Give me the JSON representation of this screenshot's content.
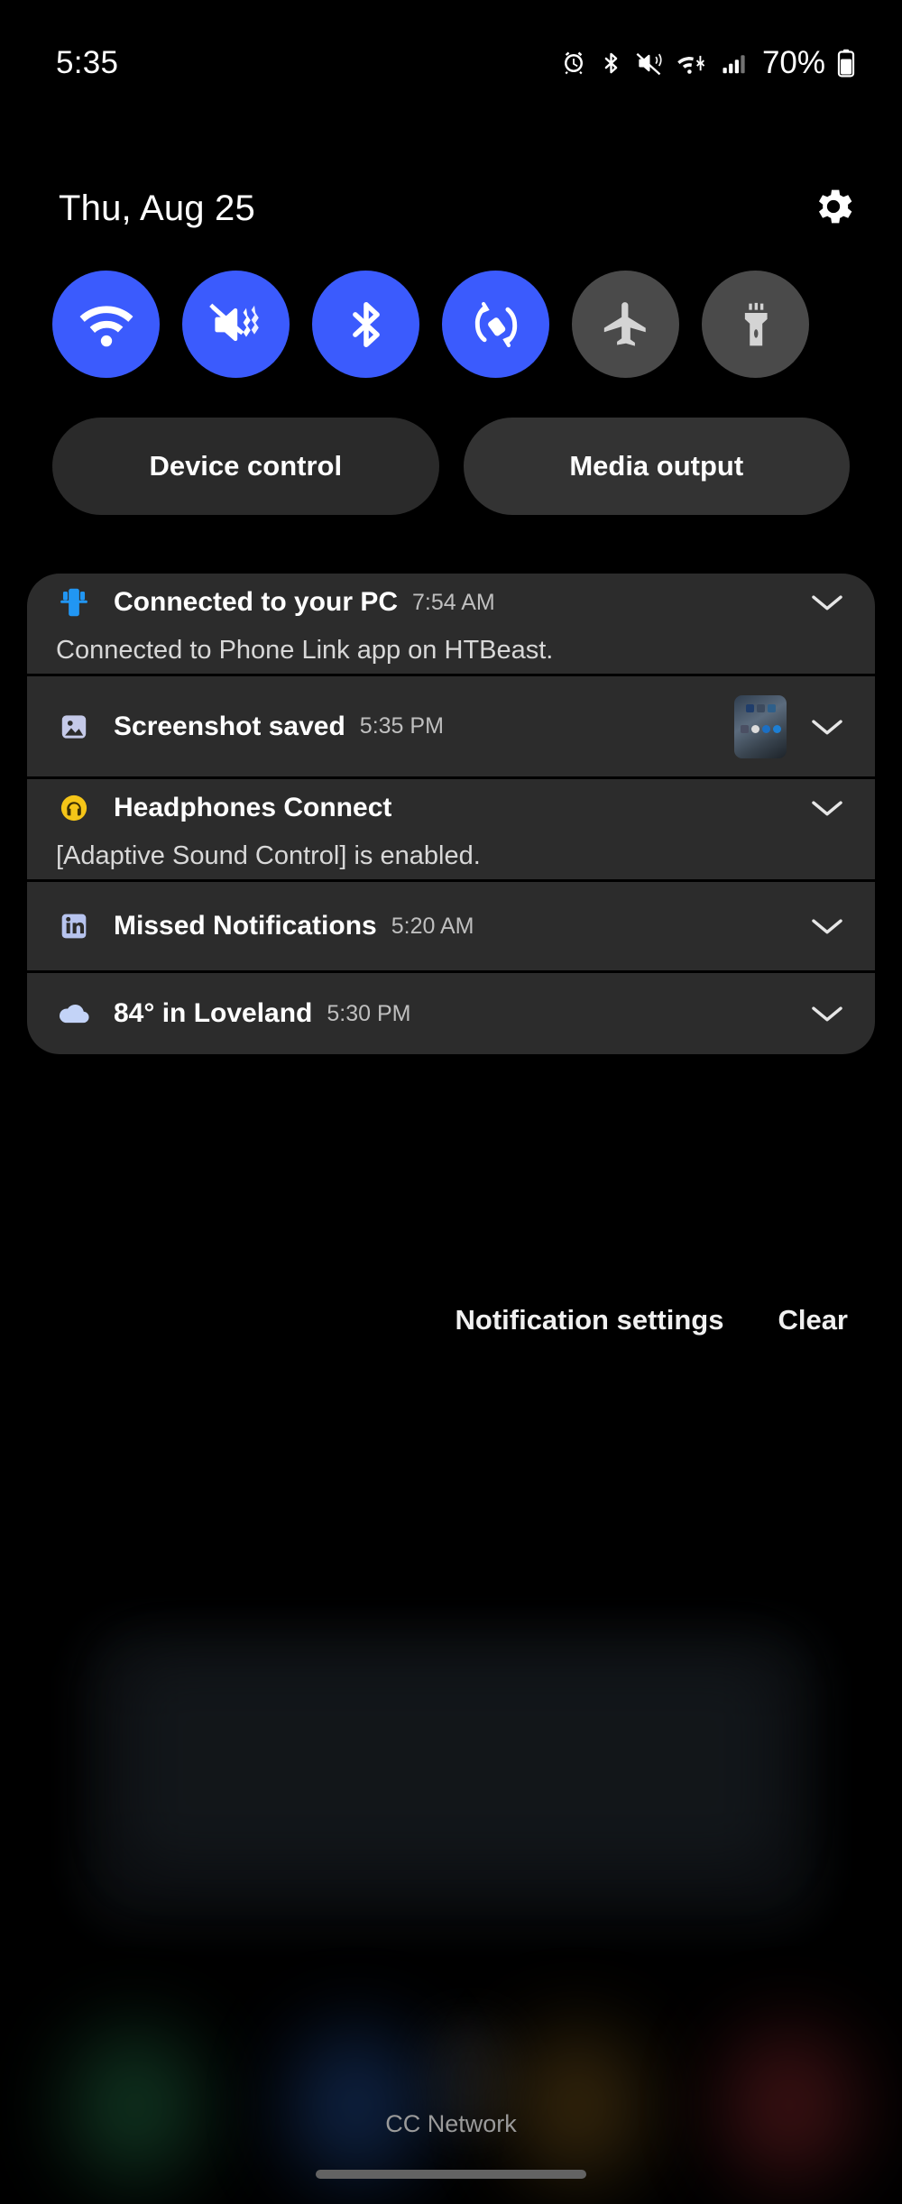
{
  "status_bar": {
    "clock": "5:35",
    "battery_percent": "70%",
    "icons": [
      "alarm-icon",
      "bluetooth-icon",
      "vibrate-mute-icon",
      "wifi-data-icon",
      "signal-bars-icon",
      "battery-icon"
    ]
  },
  "shade_header": {
    "date": "Thu, Aug 25",
    "settings_icon": "gear-icon"
  },
  "quick_settings": {
    "tiles": [
      {
        "name": "wifi",
        "icon": "wifi-icon",
        "label": "Wi-Fi",
        "state": "on"
      },
      {
        "name": "sound-mode",
        "icon": "vibrate-icon",
        "label": "Vibrate",
        "state": "on"
      },
      {
        "name": "bluetooth",
        "icon": "bluetooth-icon",
        "label": "Bluetooth",
        "state": "on"
      },
      {
        "name": "auto-rotate",
        "icon": "auto-rotate-icon",
        "label": "Auto rotate",
        "state": "on"
      },
      {
        "name": "airplane",
        "icon": "airplane-icon",
        "label": "Airplane mode",
        "state": "off"
      },
      {
        "name": "flashlight",
        "icon": "flashlight-icon",
        "label": "Flashlight",
        "state": "off"
      }
    ],
    "on_color": "#3b5bfd",
    "off_color": "#4a4a4a"
  },
  "controls": {
    "device_control": "Device control",
    "media_output": "Media output"
  },
  "notifications": [
    {
      "id": "connected-to-pc",
      "icon": "phone-link-icon",
      "icon_color": "#2196f3",
      "title": "Connected to your PC",
      "time": "7:54 AM",
      "body": "Connected to Phone Link app on HTBeast.",
      "has_thumbnail": false
    },
    {
      "id": "screenshot-saved",
      "icon": "image-icon",
      "icon_color": "#c5cae9",
      "title": "Screenshot saved",
      "time": "5:35 PM",
      "body": "",
      "has_thumbnail": true
    },
    {
      "id": "headphones-connect",
      "icon": "headphones-icon",
      "icon_color": "#f5c518",
      "title": "Headphones Connect",
      "time": "",
      "body": "[Adaptive Sound Control] is enabled.",
      "has_thumbnail": false
    },
    {
      "id": "linkedin-missed",
      "icon": "linkedin-icon",
      "icon_color": "#b7c4ef",
      "title": "Missed Notifications",
      "time": "5:20 AM",
      "body": "",
      "has_thumbnail": false
    },
    {
      "id": "weather-loveland",
      "icon": "cloud-icon",
      "icon_color": "#c3d3f7",
      "title": "84° in Loveland",
      "time": "5:30 PM",
      "body": "",
      "has_thumbnail": false
    }
  ],
  "notification_footer": {
    "settings_label": "Notification settings",
    "clear_label": "Clear"
  },
  "bottom": {
    "carrier": "CC Network"
  },
  "theme": {
    "background": "#000000",
    "notification_card": "#2c2c2c",
    "accent_blue": "#3b5bfd",
    "text_primary": "#ffffff",
    "text_secondary": "#bfbfbf"
  }
}
